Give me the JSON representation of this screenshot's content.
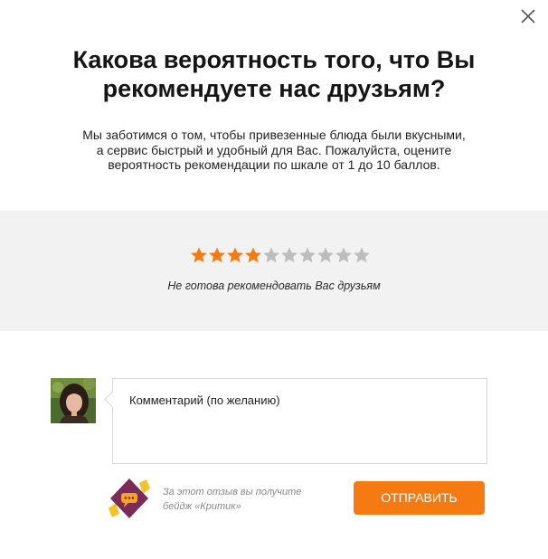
{
  "modal": {
    "title_line1": "Какова вероятность того, что Вы",
    "title_line2": "рекомендуете нас друзьям?",
    "subtitle_line1": "Мы заботимся о том, чтобы привезенные блюда были вкусными,",
    "subtitle_line2": "а сервис быстрый и удобный для Вас. Пожалуйста, оцените",
    "subtitle_line3": "вероятность рекомендации по шкале от 1 до 10 баллов.",
    "close_icon": "close-icon"
  },
  "rating": {
    "value": 4,
    "max": 10,
    "label": "Не готова рекомендовать Вас друзьям",
    "active_color": "#f57a12",
    "inactive_color": "#bdbdbd"
  },
  "comment": {
    "placeholder": "Комментарий (по желанию)",
    "value": ""
  },
  "badge": {
    "icon": "critic-badge-icon",
    "text_line1": "За этот отзыв вы получите",
    "text_line2": "бейдж «Критик»"
  },
  "submit": {
    "label": "ОТПРАВИТЬ",
    "color": "#f57a12"
  }
}
